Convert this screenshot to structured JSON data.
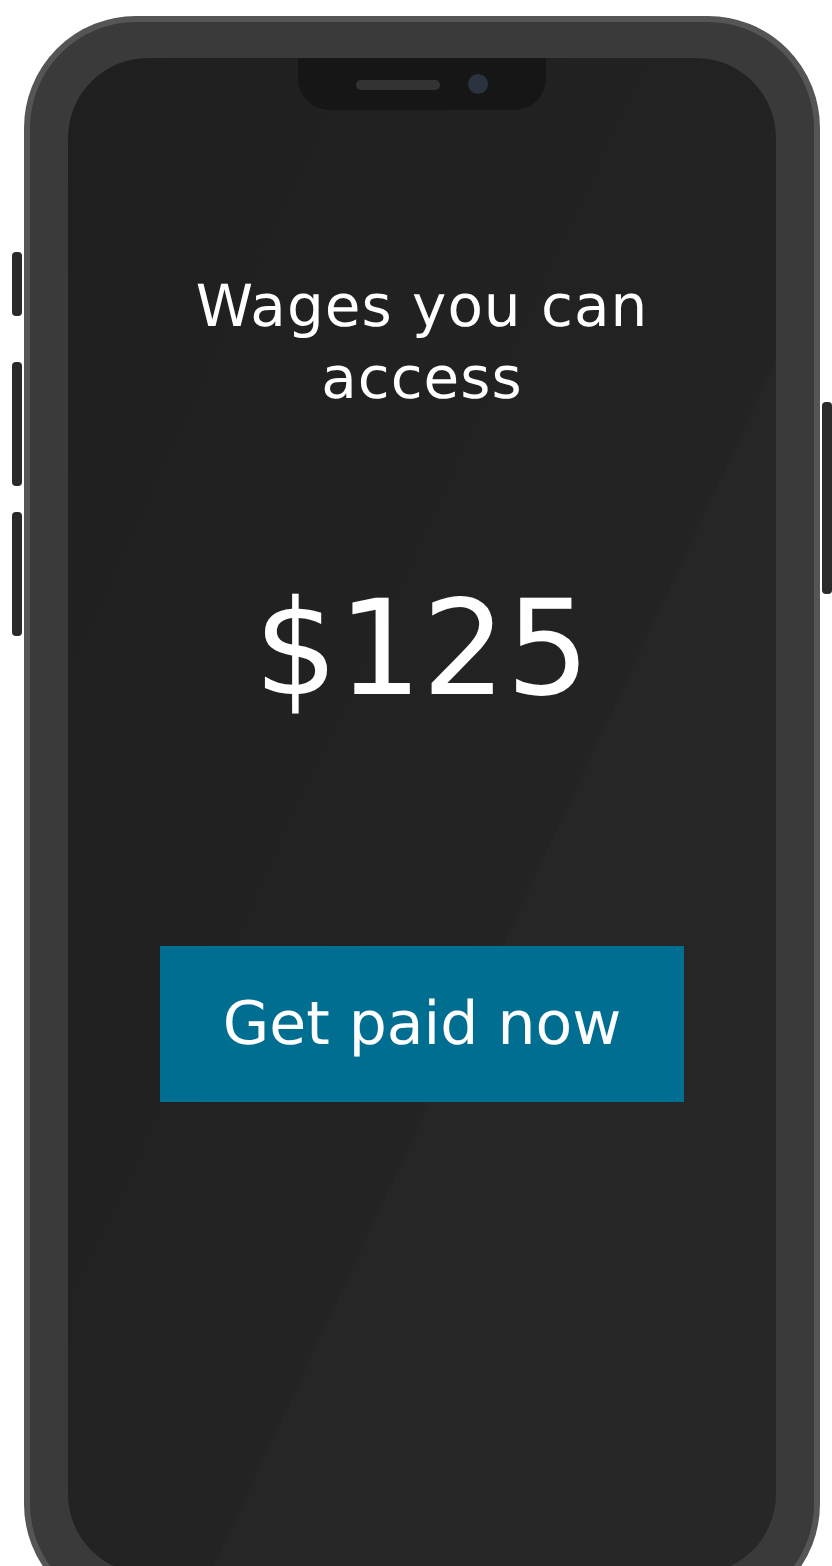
{
  "screen": {
    "title": "Wages you can access",
    "amount": "$125",
    "button": "Get paid now"
  }
}
